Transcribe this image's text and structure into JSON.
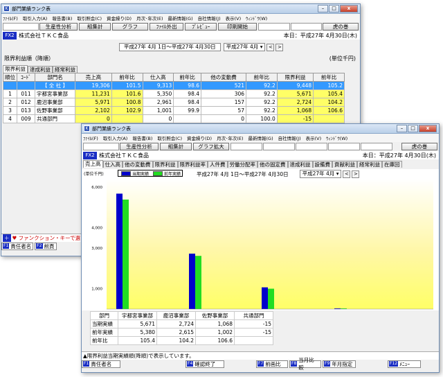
{
  "back": {
    "title": "部門業績ランク表",
    "menu": [
      "ﾌｧｲﾙ(F)",
      "取引入力(A)",
      "報告書(B)",
      "取引照会(C)",
      "資金繰り(D)",
      "月次･年次(E)",
      "最新情報(G)",
      "自社情報(J)",
      "表示(V)",
      "ｳｨﾝﾄﾞｳ(W)"
    ],
    "toolbar": [
      "生産性分析",
      "組集計",
      "グラフ",
      "ﾌｧｲﾙ外出",
      "ﾌﾟﾚﾋﾞｭｰ",
      "印刷開始"
    ],
    "tora": "虎の巻",
    "fx": "FX2",
    "company": "株式会社ＴＫＣ食品",
    "today": "本日：平成27年 4月30日(木)",
    "period": "平成27年 4月 1日～平成27年 4月30日",
    "period_select": "平成27年 4月",
    "ranking": "限界利益順（降順）",
    "unit": "(単位千円)",
    "tabs": [
      "限界利益",
      "達成利益",
      "経常利益"
    ],
    "headers": [
      "順位",
      "ｺｰﾄﾞ",
      "部門名",
      "売上高",
      "前年比",
      "仕入高",
      "前年比",
      "他の変動費",
      "前年比",
      "限界利益",
      "前年比"
    ],
    "rows": [
      {
        "rank": "",
        "code": "",
        "name": "【 全 社 】",
        "sales": "19,306",
        "r1": "101.5",
        "buy": "9,313",
        "r2": "98.6",
        "other": "521",
        "r3": "92.2",
        "profit": "9,448",
        "r4": "105.2"
      },
      {
        "rank": "1",
        "code": "011",
        "name": "宇都宮事業部",
        "sales": "11,231",
        "r1": "101.6",
        "buy": "5,350",
        "r2": "98.4",
        "other": "306",
        "r3": "92.2",
        "profit": "5,671",
        "r4": "105.4"
      },
      {
        "rank": "2",
        "code": "012",
        "name": "鹿沼事業部",
        "sales": "5,971",
        "r1": "100.8",
        "buy": "2,961",
        "r2": "98.4",
        "other": "157",
        "r3": "92.2",
        "profit": "2,724",
        "r4": "104.2"
      },
      {
        "rank": "3",
        "code": "013",
        "name": "佐野事業部",
        "sales": "2,102",
        "r1": "102.9",
        "buy": "1,001",
        "r2": "99.9",
        "other": "57",
        "r3": "92.2",
        "profit": "1,068",
        "r4": "106.6"
      },
      {
        "rank": "4",
        "code": "009",
        "name": "共通部門",
        "sales": "0",
        "r1": "",
        "buy": "0",
        "r2": "",
        "other": "0",
        "r3": "100.0",
        "profit": "-15",
        "r4": ""
      }
    ],
    "func": "♥ ファンクション・キーで選",
    "fkeys": [
      "責任者名",
      "前頁"
    ]
  },
  "front": {
    "title": "部門業績ランク表",
    "menu": [
      "ﾌｧｲﾙ(F)",
      "取引入力(A)",
      "報告書(B)",
      "取引照会(C)",
      "資金繰り(D)",
      "月次･年次(E)",
      "最新情報(G)",
      "自社情報(J)",
      "表示(V)",
      "ｳｨﾝﾄﾞｳ(W)"
    ],
    "toolbar": [
      "生産性分析",
      "組集計",
      "グラフ拡大"
    ],
    "tora": "虎の巻",
    "fx": "FX2",
    "company": "株式会社ＴＫＣ食品",
    "today": "本日：平成27年 4月30日(木)",
    "tabs": [
      "売上高",
      "仕入高",
      "他の変動費",
      "限界利益",
      "限界利益率",
      "人件費",
      "労働分配率",
      "他の固定費",
      "達成利益",
      "設備費",
      "貢献利益",
      "経常利益",
      "在庫回"
    ],
    "period": "平成27年 4月 1日～平成27年 4月30日",
    "period_select": "平成27年 4月",
    "legend": {
      "s1": "当期実績",
      "s2": "前年実績"
    },
    "table_headers": [
      "部門",
      "宇都宮事業部",
      "鹿沼事業部",
      "佐野事業部",
      "共通部門"
    ],
    "table_rows": [
      {
        "label": "当期実績",
        "v": [
          "5,671",
          "2,724",
          "1,068",
          "-15"
        ]
      },
      {
        "label": "前年実績",
        "v": [
          "5,380",
          "2,615",
          "1,002",
          "-15"
        ]
      },
      {
        "label": "前年比",
        "v": [
          "105.4",
          "104.2",
          "106.6",
          ""
        ]
      }
    ],
    "status": "▲限界利益当期実績順(降順)で表示しています。",
    "fkeys": [
      "責任者名",
      "確認終了",
      "前画比",
      "当月比較",
      "年月指定",
      "ﾒﾆｭｰ"
    ]
  },
  "chart_data": {
    "type": "bar",
    "ylabel": "(単位千円)",
    "categories": [
      "宇都宮事業部",
      "鹿沼事業部",
      "佐野事業部",
      "共通部門"
    ],
    "series": [
      {
        "name": "当期実績",
        "values": [
          5671,
          2724,
          1068,
          -15
        ]
      },
      {
        "name": "前年実績",
        "values": [
          5380,
          2615,
          1002,
          -15
        ]
      }
    ],
    "yticks": [
      "1,000",
      "3,000",
      "4,000",
      "6,000"
    ],
    "ylim": [
      0,
      6000
    ],
    "colors": {
      "s1": "#0000cc",
      "s2": "#22dd22"
    }
  }
}
